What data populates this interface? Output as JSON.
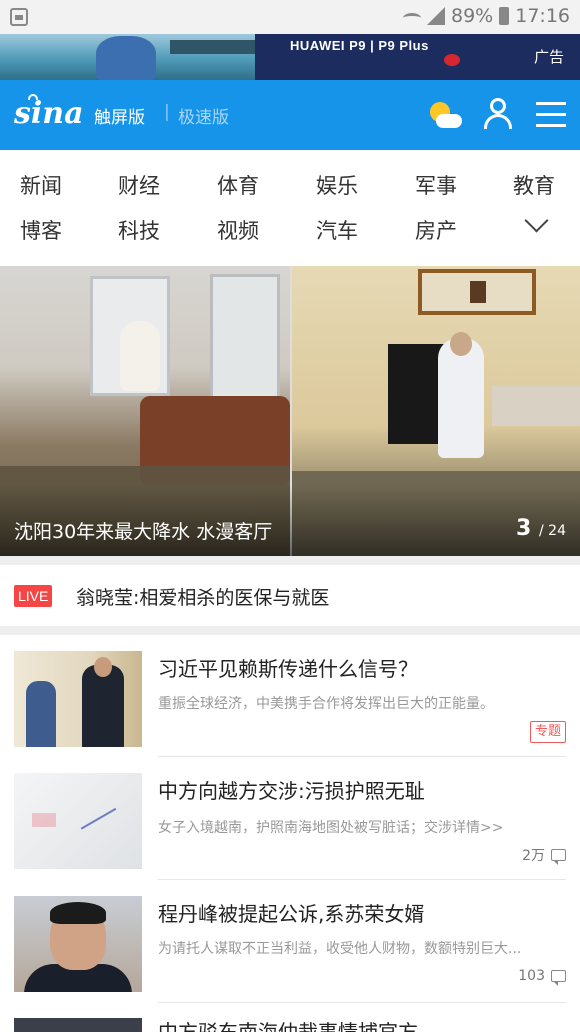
{
  "status_bar": {
    "battery": "89%",
    "time": "17:16"
  },
  "ad": {
    "brand": "HUAWEI P9 | P9 Plus",
    "tag": "广告"
  },
  "header": {
    "logo": "sina",
    "version_active": "触屏版",
    "separator": "|",
    "version_other": "极速版"
  },
  "channels": [
    "新闻",
    "财经",
    "体育",
    "娱乐",
    "军事",
    "教育",
    "博客",
    "科技",
    "视频",
    "汽车",
    "房产"
  ],
  "hero": {
    "caption": "沈阳30年来最大降水 水漫客厅",
    "index": "3",
    "total": "/ 24"
  },
  "live": {
    "badge": "LIVE",
    "title": "翁晓莹:相爱相杀的医保与就医"
  },
  "news": [
    {
      "title": "习近平见赖斯传递什么信号？",
      "summary": "重振全球经济，中美携手合作将发挥出巨大的正能量。",
      "tag": "专题"
    },
    {
      "title": "中方向越方交涉:污损护照无耻",
      "summary": "女子入境越南，护照南海地图处被写脏话；交涉详情>>",
      "comments": "2万"
    },
    {
      "title": "程丹峰被提起公诉,系苏荣女婿",
      "summary": "为请托人谋取不正当利益，收受他人财物，数额特别巨大...",
      "comments": "103"
    }
  ],
  "partial_news": {
    "title": "中方驳东南海仲裁事情捕官方"
  }
}
